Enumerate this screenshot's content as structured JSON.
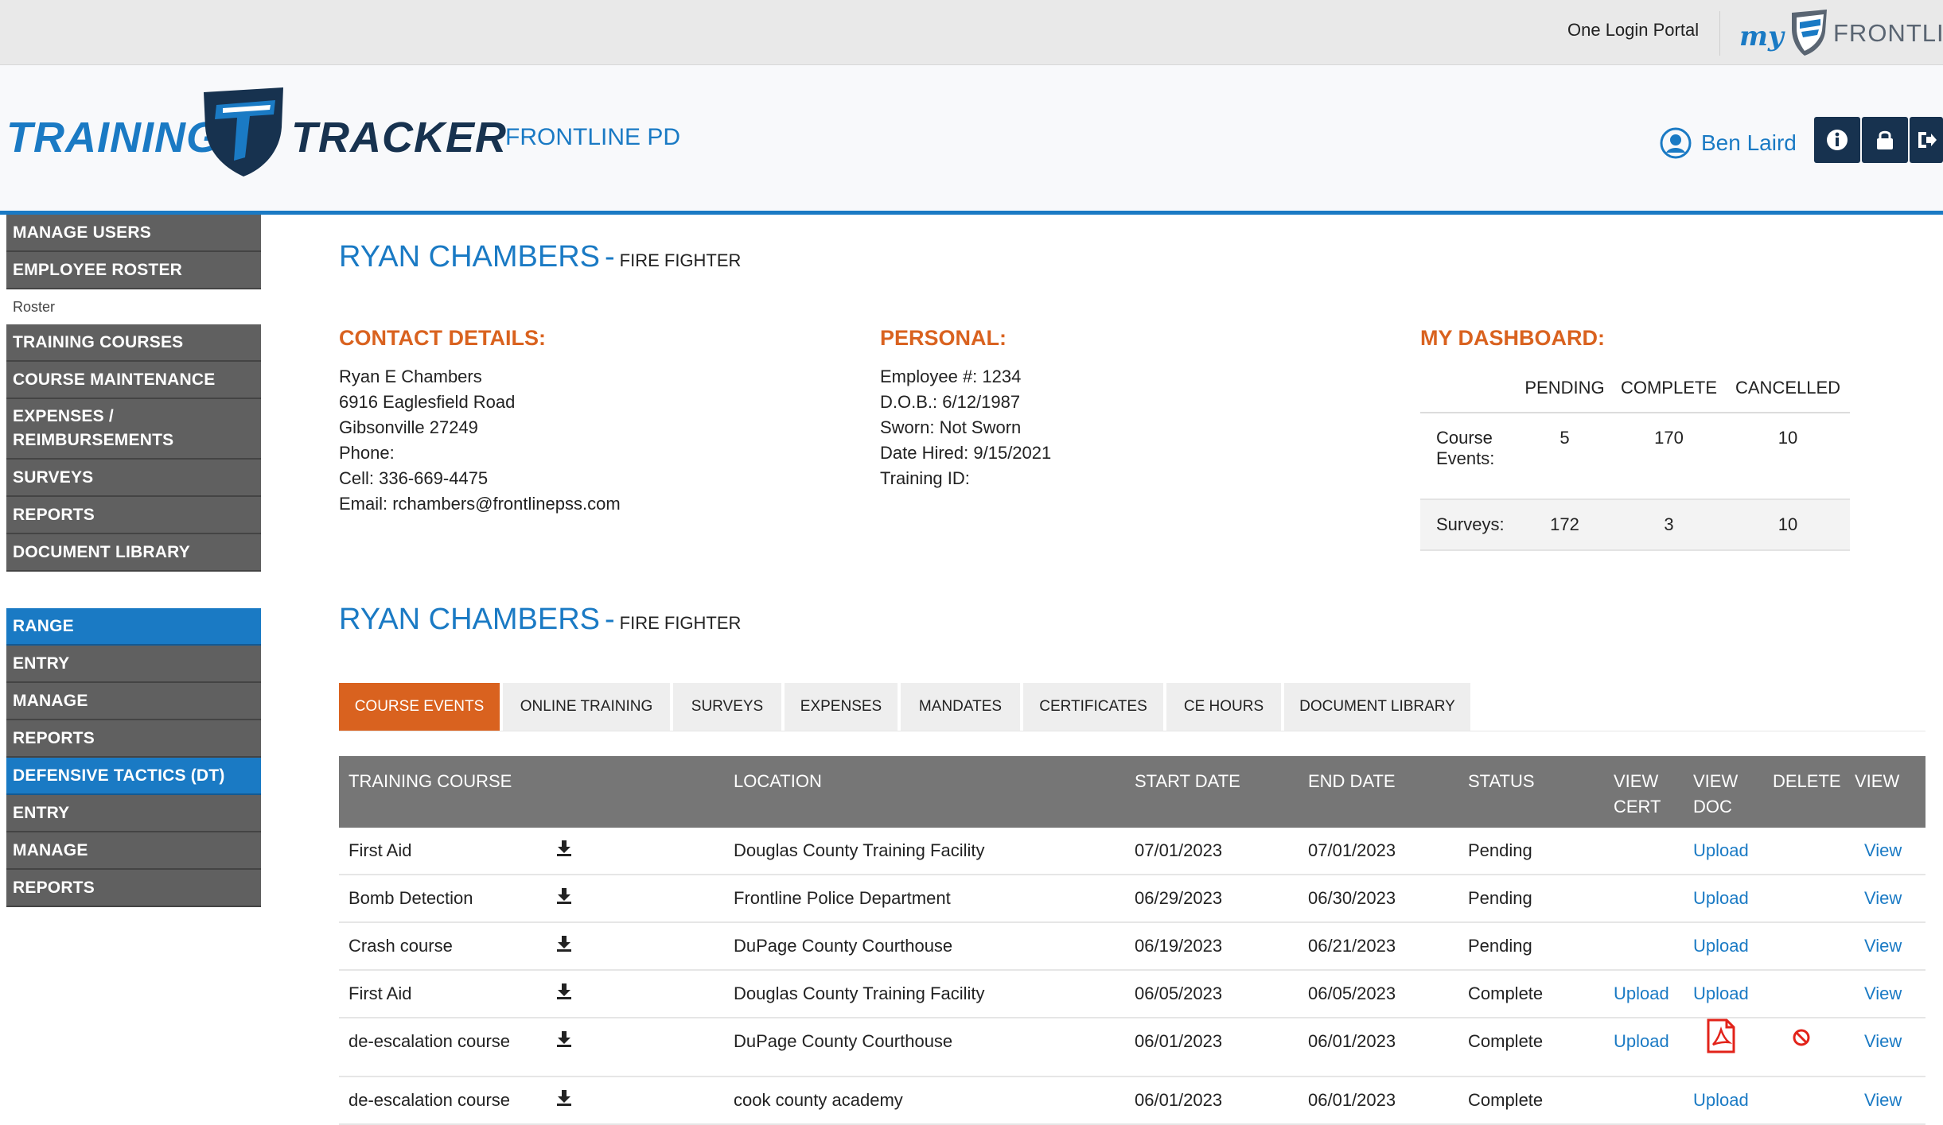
{
  "topbar": {
    "portal_link": "One Login Portal",
    "brand_my": "my",
    "brand_name": "FRONTLINE"
  },
  "header": {
    "logo_left": "TRAINING",
    "logo_right": "TRACKER",
    "agency": "FRONTLINE PD",
    "user_name": "Ben Laird",
    "buttons": [
      "info-icon",
      "lock-icon",
      "logout-icon"
    ]
  },
  "sidebar": {
    "main": [
      {
        "label": "MANAGE USERS"
      },
      {
        "label": "EMPLOYEE ROSTER"
      },
      {
        "label": "Roster"
      },
      {
        "label": "TRAINING COURSES"
      },
      {
        "label": "COURSE MAINTENANCE"
      },
      {
        "label": "EXPENSES / REIMBURSEMENTS"
      },
      {
        "label": "SURVEYS"
      },
      {
        "label": "REPORTS"
      },
      {
        "label": "DOCUMENT LIBRARY"
      }
    ],
    "range": [
      {
        "label": "RANGE"
      },
      {
        "label": "ENTRY"
      },
      {
        "label": "MANAGE"
      },
      {
        "label": "REPORTS"
      },
      {
        "label": "DEFENSIVE TACTICS (DT)"
      },
      {
        "label": "ENTRY"
      },
      {
        "label": "MANAGE"
      },
      {
        "label": "REPORTS"
      }
    ]
  },
  "profile": {
    "name": "RYAN CHAMBERS",
    "separator": "-",
    "rank": "FIRE FIGHTER"
  },
  "contact": {
    "title": "CONTACT DETAILS:",
    "lines": [
      "Ryan E Chambers",
      "6916 Eaglesfield Road",
      "Gibsonville 27249",
      "Phone:",
      "Cell: 336-669-4475",
      "Email: rchambers@frontlinepss.com"
    ]
  },
  "personal": {
    "title": "PERSONAL:",
    "lines": [
      "Employee #: 1234",
      "D.O.B.: 6/12/1987",
      "Sworn: Not Sworn",
      "Date Hired: 9/15/2021",
      "Training ID:"
    ]
  },
  "dashboard": {
    "title": "MY DASHBOARD:",
    "columns": [
      "PENDING",
      "COMPLETE",
      "CANCELLED"
    ],
    "rows": [
      {
        "label_l1": "Course",
        "label_l2": "Events:",
        "pending": "5",
        "complete": "170",
        "cancelled": "10"
      },
      {
        "label_l1": "Surveys:",
        "label_l2": "",
        "pending": "172",
        "complete": "3",
        "cancelled": "10"
      }
    ]
  },
  "tabs": [
    "COURSE EVENTS",
    "ONLINE TRAINING",
    "SURVEYS",
    "EXPENSES",
    "MANDATES",
    "CERTIFICATES",
    "CE HOURS",
    "DOCUMENT LIBRARY"
  ],
  "table": {
    "headers": {
      "course": "TRAINING COURSE",
      "location": "LOCATION",
      "start": "START DATE",
      "end": "END DATE",
      "status": "STATUS",
      "view_cert_l1": "VIEW",
      "view_cert_l2": "CERT",
      "view_doc_l1": "VIEW",
      "view_doc_l2": "DOC",
      "delete": "DELETE",
      "view": "VIEW"
    },
    "rows": [
      {
        "course": "First Aid",
        "location": "Douglas County Training Facility",
        "start": "07/01/2023",
        "end": "07/01/2023",
        "status": "Pending",
        "cert": "",
        "doc": "Upload",
        "view": "View"
      },
      {
        "course": "Bomb Detection",
        "location": "Frontline Police Department",
        "start": "06/29/2023",
        "end": "06/30/2023",
        "status": "Pending",
        "cert": "",
        "doc": "Upload",
        "view": "View"
      },
      {
        "course": "Crash course",
        "location": "DuPage County Courthouse",
        "start": "06/19/2023",
        "end": "06/21/2023",
        "status": "Pending",
        "cert": "",
        "doc": "Upload",
        "view": "View"
      },
      {
        "course": "First Aid",
        "location": "Douglas County Training Facility",
        "start": "06/05/2023",
        "end": "06/05/2023",
        "status": "Complete",
        "cert": "Upload",
        "doc": "Upload",
        "view": "View"
      },
      {
        "course": "de-escalation course",
        "location": "DuPage County Courthouse",
        "start": "06/01/2023",
        "end": "06/01/2023",
        "status": "Complete",
        "cert": "Upload",
        "doc": "",
        "doc_icon": "pdf-icon",
        "delete_icon": "delete-icon",
        "view": "View"
      },
      {
        "course": "de-escalation course",
        "location": "cook county academy",
        "start": "06/01/2023",
        "end": "06/01/2023",
        "status": "Complete",
        "cert": "",
        "doc": "Upload",
        "view": "View"
      }
    ]
  },
  "colors": {
    "brand_blue": "#1a7ac4",
    "navy": "#17324f",
    "accent_orange": "#d9621f",
    "sidebar_grey": "#606060"
  }
}
